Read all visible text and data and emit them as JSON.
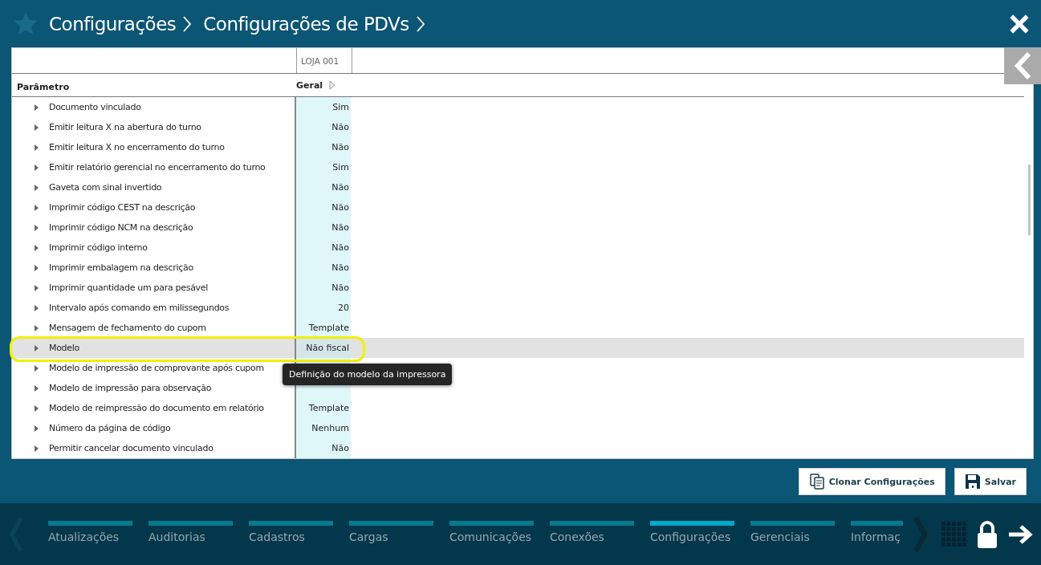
{
  "header": {
    "breadcrumbs": [
      "Configurações",
      "Configurações de PDVs"
    ]
  },
  "table": {
    "store_column": "LOJA 001",
    "columns": [
      "Parâmetro",
      "Geral"
    ],
    "rows": [
      {
        "label": "Documento vinculado",
        "value": "Sim",
        "selected": false
      },
      {
        "label": "Emitir leitura X na abertura do turno",
        "value": "Não",
        "selected": false
      },
      {
        "label": "Emitir leitura X no encerramento do turno",
        "value": "Não",
        "selected": false
      },
      {
        "label": "Emitir relatório gerencial no encerramento do turno",
        "value": "Sim",
        "selected": false
      },
      {
        "label": "Gaveta com sinal invertido",
        "value": "Não",
        "selected": false
      },
      {
        "label": "Imprimir código CEST na descrição",
        "value": "Não",
        "selected": false
      },
      {
        "label": "Imprimir código NCM na descrição",
        "value": "Não",
        "selected": false
      },
      {
        "label": "Imprimir código interno",
        "value": "Não",
        "selected": false
      },
      {
        "label": "Imprimir embalagem na descrição",
        "value": "Não",
        "selected": false
      },
      {
        "label": "Imprimir quantidade um para pesável",
        "value": "Não",
        "selected": false
      },
      {
        "label": "Intervalo após comando em milissegundos",
        "value": "20",
        "selected": false
      },
      {
        "label": "Mensagem de fechamento do cupom",
        "value": "Template",
        "selected": false
      },
      {
        "label": "Modelo",
        "value": "Não fiscal",
        "selected": true,
        "highlighted": true
      },
      {
        "label": "Modelo de impressão de comprovante após cupom",
        "selected": false
      },
      {
        "label": "Modelo de impressão para observação",
        "selected": false
      },
      {
        "label": "Modelo de reimpressão do documento em relatório",
        "value": "Template",
        "selected": false
      },
      {
        "label": "Número da página de código",
        "value": "Nenhum",
        "selected": false
      },
      {
        "label": "Permitir cancelar documento vinculado",
        "value": "Não",
        "selected": false
      }
    ]
  },
  "tooltip": {
    "text": "Definição do modelo da impressora"
  },
  "buttons": [
    "Clonar Configurações",
    "Salvar"
  ],
  "nav_tabs": [
    {
      "label": "Atualizações",
      "selected": false
    },
    {
      "label": "Auditorias",
      "selected": false
    },
    {
      "label": "Cadastros",
      "selected": false
    },
    {
      "label": "Cargas",
      "selected": false
    },
    {
      "label": "Comunicações",
      "selected": false
    },
    {
      "label": "Conexões",
      "selected": false
    },
    {
      "label": "Configurações",
      "selected": true
    },
    {
      "label": "Gerenciais",
      "selected": false
    },
    {
      "label": "Informaç",
      "selected": false
    }
  ]
}
